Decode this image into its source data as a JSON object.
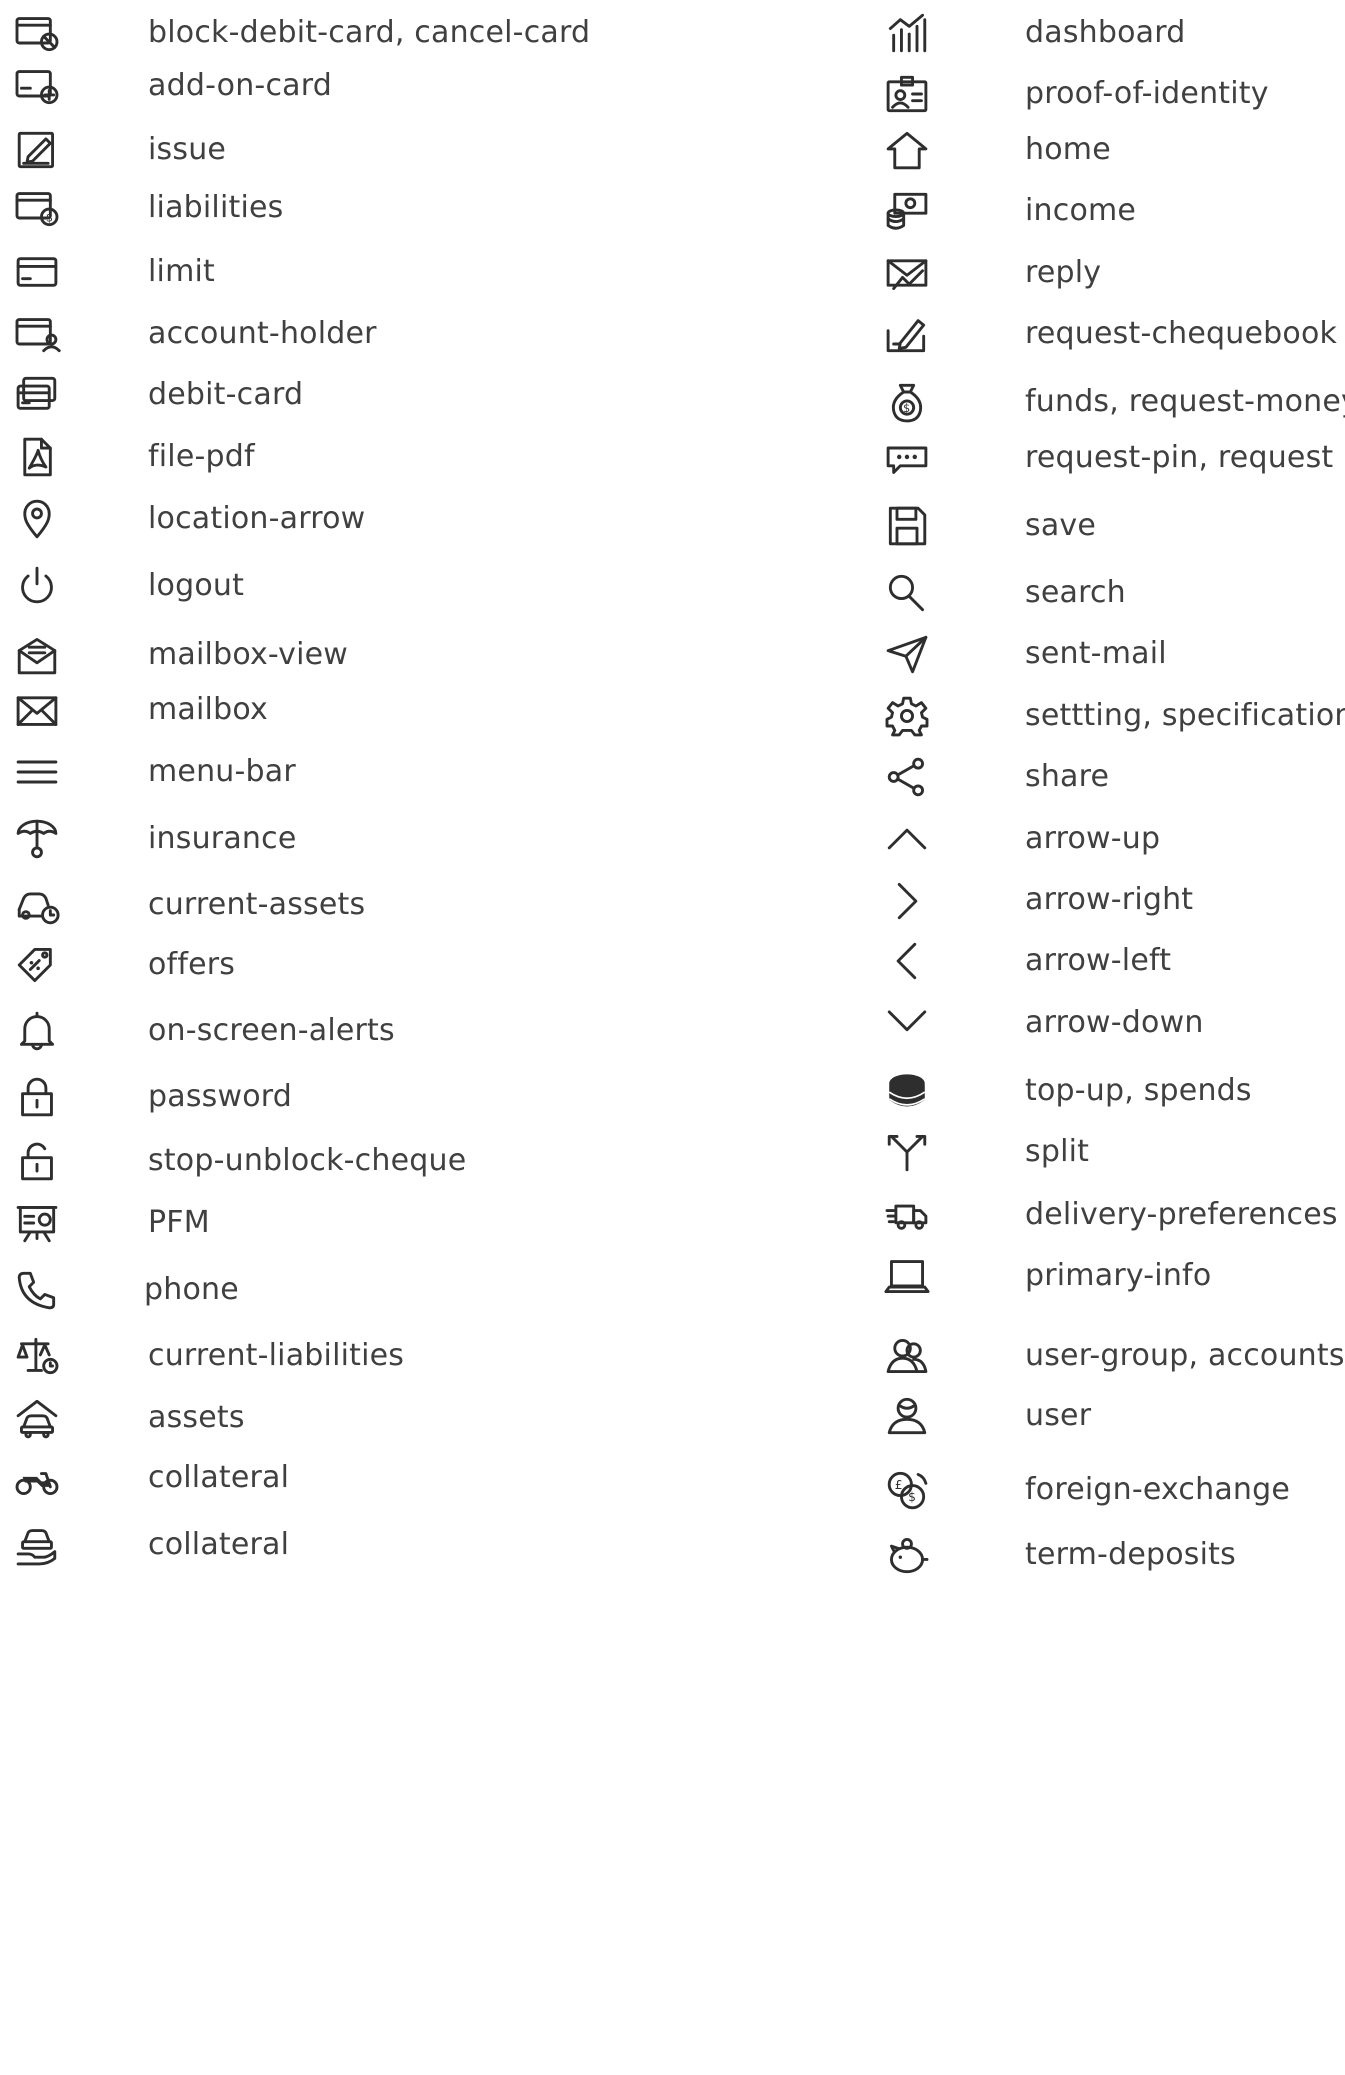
{
  "left_column": [
    {
      "icon": "block-debit-card-icon",
      "label": "block-debit-card, cancel-card"
    },
    {
      "icon": "add-on-card-icon",
      "label": "add-on-card"
    },
    {
      "icon": "issue-icon",
      "label": "issue"
    },
    {
      "icon": "liabilities-icon",
      "label": "liabilities"
    },
    {
      "icon": "limit-icon",
      "label": "limit"
    },
    {
      "icon": "account-holder-icon",
      "label": "account-holder"
    },
    {
      "icon": "debit-card-icon",
      "label": "debit-card"
    },
    {
      "icon": "file-pdf-icon",
      "label": "file-pdf"
    },
    {
      "icon": "location-arrow-icon",
      "label": "location-arrow"
    },
    {
      "icon": "logout-icon",
      "label": "logout"
    },
    {
      "icon": "mailbox-view-icon",
      "label": "mailbox-view"
    },
    {
      "icon": "mailbox-icon",
      "label": "mailbox"
    },
    {
      "icon": "menu-bar-icon",
      "label": "menu-bar"
    },
    {
      "icon": "insurance-icon",
      "label": "insurance"
    },
    {
      "icon": "current-assets-icon",
      "label": "current-assets"
    },
    {
      "icon": "offers-icon",
      "label": "offers"
    },
    {
      "icon": "on-screen-alerts-icon",
      "label": "on-screen-alerts"
    },
    {
      "icon": "password-icon",
      "label": "password"
    },
    {
      "icon": "stop-unblock-cheque-icon",
      "label": "stop-unblock-cheque"
    },
    {
      "icon": "pfm-icon",
      "label": "PFM"
    },
    {
      "icon": "phone-icon",
      "label": "phone"
    },
    {
      "icon": "current-liabilities-icon",
      "label": "current-liabilities"
    },
    {
      "icon": "assets-icon",
      "label": "assets"
    },
    {
      "icon": "collateral-motorbike-icon",
      "label": "collateral"
    },
    {
      "icon": "collateral-car-hand-icon",
      "label": "collateral"
    }
  ],
  "right_column": [
    {
      "icon": "dashboard-icon",
      "label": "dashboard"
    },
    {
      "icon": "proof-of-identity-icon",
      "label": "proof-of-identity"
    },
    {
      "icon": "home-icon",
      "label": "home"
    },
    {
      "icon": "income-icon",
      "label": "income"
    },
    {
      "icon": "reply-icon",
      "label": "reply"
    },
    {
      "icon": "request-chequebook-icon",
      "label": "request-chequebook"
    },
    {
      "icon": "funds-icon",
      "label": "funds, request-money"
    },
    {
      "icon": "request-pin-icon",
      "label": "request-pin, request"
    },
    {
      "icon": "save-icon",
      "label": "save"
    },
    {
      "icon": "search-icon",
      "label": "search"
    },
    {
      "icon": "sent-mail-icon",
      "label": "sent-mail"
    },
    {
      "icon": "setting-icon",
      "label": "settting, specifications"
    },
    {
      "icon": "share-icon",
      "label": "share"
    },
    {
      "icon": "arrow-up-icon",
      "label": "arrow-up"
    },
    {
      "icon": "arrow-right-icon",
      "label": "arrow-right"
    },
    {
      "icon": "arrow-left-icon",
      "label": "arrow-left"
    },
    {
      "icon": "arrow-down-icon",
      "label": "arrow-down"
    },
    {
      "icon": "top-up-icon",
      "label": "top-up, spends"
    },
    {
      "icon": "split-icon",
      "label": "split"
    },
    {
      "icon": "delivery-preferences-icon",
      "label": "delivery-preferences"
    },
    {
      "icon": "primary-info-icon",
      "label": "primary-info"
    },
    {
      "icon": "user-group-icon",
      "label": "user-group, accounts"
    },
    {
      "icon": "user-icon",
      "label": "user"
    },
    {
      "icon": "foreign-exchange-icon",
      "label": "foreign-exchange"
    },
    {
      "icon": "term-deposits-icon",
      "label": "term-deposits"
    }
  ]
}
